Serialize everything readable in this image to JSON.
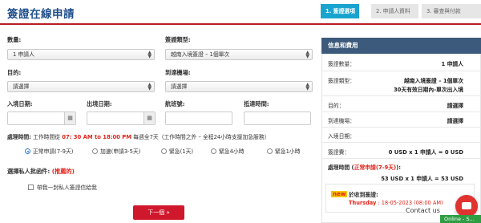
{
  "header": {
    "title": "簽證在線申請",
    "steps": [
      {
        "label": "1. 簽證選項",
        "active": true
      },
      {
        "label": "2. 申請人資料",
        "active": false
      },
      {
        "label": "3. 審查與付款",
        "active": false
      }
    ]
  },
  "form": {
    "quantity_label": "數量:",
    "quantity_value": "1 申請人",
    "visa_type_label": "簽證類型:",
    "visa_type_value": "越南入境簽證 – 1個單次",
    "purpose_label": "目的:",
    "purpose_value": "請選擇",
    "airport_label": "到達機場:",
    "airport_value": "請選擇",
    "entry_date_label": "入境日期:",
    "exit_date_label": "出境日期:",
    "flight_label": "航班號:",
    "arrival_time_label": "抵達時間:",
    "calendar_icon": "calendar-icon",
    "processing_label": "處理時間:",
    "processing_prefix": "工作時間從",
    "processing_hours": "07: 30 AM to 18:00 PM",
    "processing_suffix": "每週全7天（工作時間之外 – 全程24小時支援加急服務）",
    "processing_options": [
      "正常申請(7-9天)",
      "加速(申請3-5天)",
      "緊急(1天)",
      "緊急4小時",
      "緊急1小時"
    ],
    "private_label": "選擇私人批函件:",
    "private_note": "(推薦的)",
    "private_option": "帶我一封私人簽證信給我",
    "next_button": "下一個 »"
  },
  "summary": {
    "title": "信息和費用",
    "rows": [
      {
        "label": "簽證數量：",
        "value": "1 申請人"
      },
      {
        "label": "簽證類型：",
        "value": "越南入境簽證 – 1個單次"
      },
      {
        "label": "",
        "value": "30天有效日期內-單次出入境"
      },
      {
        "label": "目的：",
        "value": "請選擇"
      },
      {
        "label": "到達機場：",
        "value": "請選擇"
      },
      {
        "label": "入境日期：",
        "value": ""
      },
      {
        "label": "簽證費：",
        "value": "0 USD x 1 申請人 = 0 USD"
      }
    ],
    "processing_label": "處理時間 (",
    "processing_value": "正常申請(7-9天)",
    "processing_close": "):",
    "processing_fee": "53 USD x 1 申請人 = 53 USD",
    "notice_badge": "new",
    "notice_title": "於收到簽證:",
    "notice_day": "Thursday",
    "notice_date": " : 18-05-2023 (08:00 AM)"
  },
  "widgets": {
    "contact_label": "Contact us",
    "online_label": "Online - S..."
  },
  "colors": {
    "brand_blue": "#1f4e8c",
    "step_active": "#19a4cf",
    "red": "#e2231a",
    "panel_head": "#3c5a7b"
  }
}
